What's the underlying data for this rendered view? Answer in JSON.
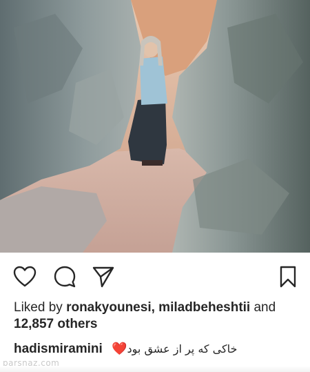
{
  "post": {
    "liked_by_prefix": "Liked by",
    "liked_user_1": "ronakyounesi,",
    "liked_user_2": "miladbeheshtii",
    "liked_and": "and",
    "others_count": "12,857 others",
    "caption_user": "hadismiramini",
    "caption_emoji": "❤️",
    "caption_text": "خاکی که پر از عشق بود"
  },
  "icons": {
    "like": "heart-icon",
    "comment": "comment-icon",
    "share": "send-icon",
    "save": "bookmark-icon"
  },
  "watermark": "parsnaz.com",
  "colors": {
    "text": "#262626",
    "icon": "#262626",
    "heart": "#e0245e",
    "rock": "#7c8a8d",
    "path": "#c8a79b"
  }
}
